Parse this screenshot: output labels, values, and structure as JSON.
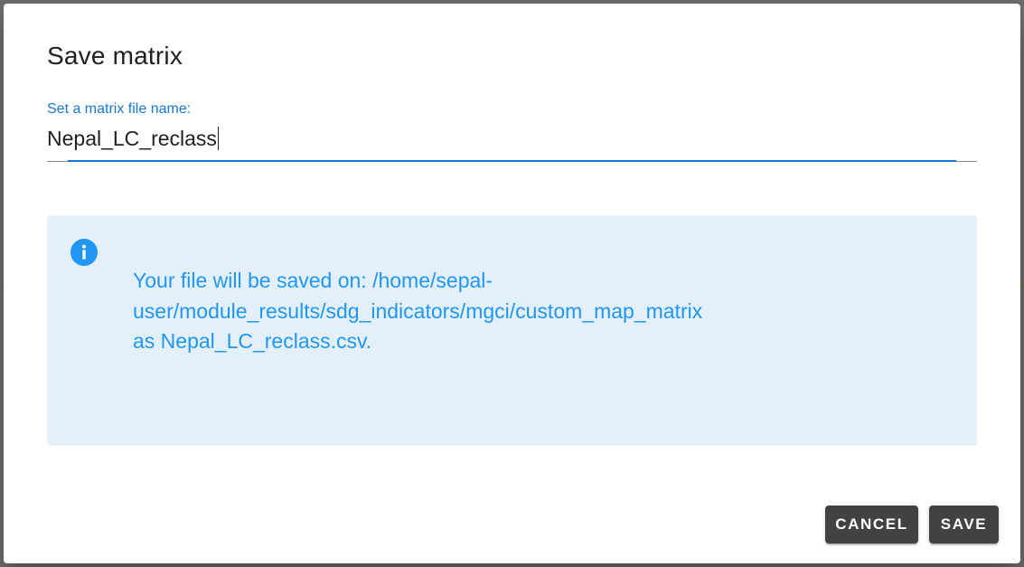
{
  "dialog": {
    "title": "Save matrix",
    "field": {
      "label": "Set a matrix file name:",
      "value": "Nepal_LC_reclass"
    },
    "alert": {
      "icon": "info-icon",
      "line1": "Your file will be saved on: /home/sepal-",
      "line2": "user/module_results/sdg_indicators/mgci/custom_map_matrix",
      "line3": "as Nepal_LC_reclass.csv."
    },
    "actions": {
      "cancel_label": "CANCEL",
      "save_label": "SAVE"
    }
  },
  "colors": {
    "accent": "#1976d2",
    "info_text": "#2196f3",
    "info_bg": "#e3f0fc",
    "button_bg": "#424242"
  }
}
